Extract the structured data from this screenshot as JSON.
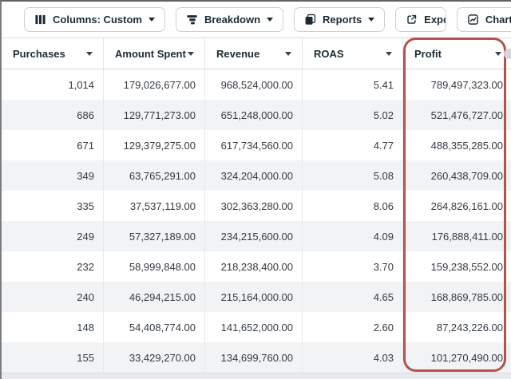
{
  "toolbar": {
    "columns_button_label": "Columns: Custom",
    "breakdown_button_label": "Breakdown",
    "reports_button_label": "Reports",
    "export_button_label": "Export",
    "charts_button_label": "Charts"
  },
  "table": {
    "columns": [
      "Purchases",
      "Amount Spent",
      "Revenue",
      "ROAS",
      "Profit"
    ],
    "rows": [
      [
        "1,014",
        "179,026,677.00",
        "968,524,000.00",
        "5.41",
        "789,497,323.00"
      ],
      [
        "686",
        "129,771,273.00",
        "651,248,000.00",
        "5.02",
        "521,476,727.00"
      ],
      [
        "671",
        "129,379,275.00",
        "617,734,560.00",
        "4.77",
        "488,355,285.00"
      ],
      [
        "349",
        "63,765,291.00",
        "324,204,000.00",
        "5.08",
        "260,438,709.00"
      ],
      [
        "335",
        "37,537,119.00",
        "302,363,280.00",
        "8.06",
        "264,826,161.00"
      ],
      [
        "249",
        "57,327,189.00",
        "234,215,600.00",
        "4.09",
        "176,888,411.00"
      ],
      [
        "232",
        "58,999,848.00",
        "218,238,400.00",
        "3.70",
        "159,238,552.00"
      ],
      [
        "240",
        "46,294,215.00",
        "215,164,000.00",
        "4.65",
        "168,869,785.00"
      ],
      [
        "148",
        "54,408,774.00",
        "141,652,000.00",
        "2.60",
        "87,243,226.00"
      ],
      [
        "155",
        "33,429,270.00",
        "134,699,760.00",
        "4.03",
        "101,270,490.00"
      ]
    ]
  },
  "annotation": {
    "highlighted_column": "Profit",
    "highlight_color": "#b5524e"
  },
  "colors": {
    "text_dark": "#1c2b33",
    "row_stripe": "#f2f3f5",
    "button_border": "#ccd0d5"
  }
}
